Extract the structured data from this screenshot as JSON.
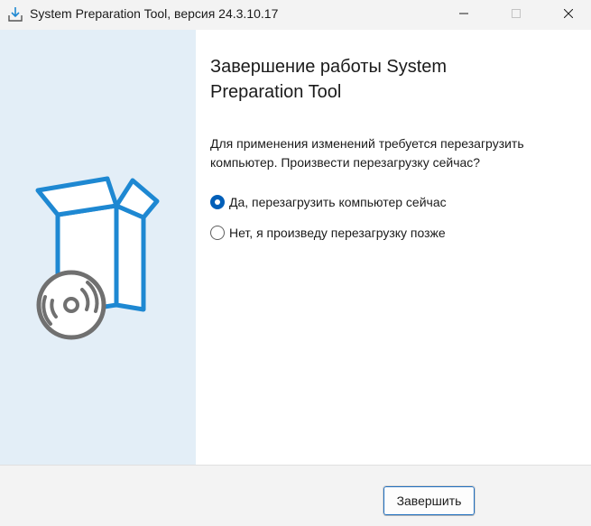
{
  "window": {
    "title": "System Preparation Tool, версия 24.3.10.17"
  },
  "titlebar": {
    "app_icon": "download-tray-icon",
    "minimize_icon": "minimize-icon",
    "maximize_icon": "maximize-icon",
    "close_icon": "close-icon"
  },
  "illustration": {
    "icon": "software-box-with-disc-icon"
  },
  "main": {
    "heading": "Завершение работы System Preparation Tool",
    "description": "Для применения изменений требуется перезагрузить компьютер. Произвести перезагрузку сейчас?",
    "options": [
      {
        "label": "Да, перезагрузить компьютер сейчас",
        "checked": true
      },
      {
        "label": "Нет, я произведу перезагрузку позже",
        "checked": false
      }
    ]
  },
  "footer": {
    "finish_label": "Завершить"
  },
  "colors": {
    "accent": "#005fb8",
    "left_panel_bg": "#e3eef7",
    "illustration_blue": "#1e88d2",
    "illustration_gray": "#707070"
  }
}
